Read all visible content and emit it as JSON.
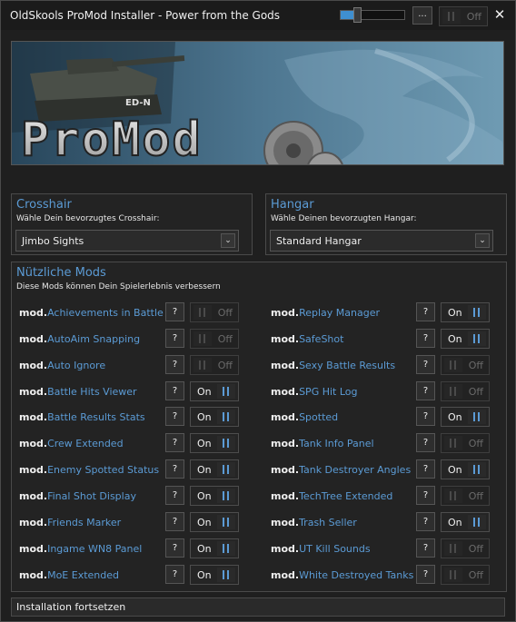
{
  "window": {
    "title": "OldSkools ProMod Installer - Power from the Gods",
    "volume_level": 0.25,
    "menu_label": "...",
    "toggle_label": "Off",
    "close_glyph": "✕"
  },
  "banner": {
    "logo_text": "ProMod",
    "tank_marking": "ED-N"
  },
  "crosshair": {
    "title": "Crosshair",
    "subtitle": "Wähle Dein bevorzugtes Crosshair:",
    "selected": "Jimbo Sights",
    "arrow": "⌄"
  },
  "hangar": {
    "title": "Hangar",
    "subtitle": "Wähle Deinen bevorzugten Hangar:",
    "selected": "Standard Hangar",
    "arrow": "⌄"
  },
  "mods": {
    "title": "Nützliche Mods",
    "subtitle": "Diese Mods können Dein Spielerlebnis verbessern",
    "prefix": "mod.",
    "help_label": "?",
    "on_label": "On",
    "off_label": "Off",
    "left": [
      {
        "name": "Achievements in Battle",
        "enabled": false
      },
      {
        "name": "AutoAim Snapping",
        "enabled": false
      },
      {
        "name": "Auto Ignore",
        "enabled": false
      },
      {
        "name": "Battle Hits Viewer",
        "enabled": true
      },
      {
        "name": "Battle Results Stats",
        "enabled": true
      },
      {
        "name": "Crew Extended",
        "enabled": true
      },
      {
        "name": "Enemy Spotted Status",
        "enabled": true
      },
      {
        "name": "Final Shot Display",
        "enabled": true
      },
      {
        "name": "Friends Marker",
        "enabled": true
      },
      {
        "name": "Ingame WN8 Panel",
        "enabled": true
      },
      {
        "name": "MoE Extended",
        "enabled": true
      }
    ],
    "right": [
      {
        "name": "Replay Manager",
        "enabled": true
      },
      {
        "name": "SafeShot",
        "enabled": true
      },
      {
        "name": "Sexy Battle Results",
        "enabled": false
      },
      {
        "name": "SPG Hit Log",
        "enabled": false
      },
      {
        "name": "Spotted",
        "enabled": true
      },
      {
        "name": "Tank Info Panel",
        "enabled": false
      },
      {
        "name": "Tank Destroyer Angles",
        "enabled": true
      },
      {
        "name": "TechTree Extended",
        "enabled": false
      },
      {
        "name": "Trash Seller",
        "enabled": true
      },
      {
        "name": "UT Kill Sounds",
        "enabled": false
      },
      {
        "name": "White Destroyed Tanks",
        "enabled": false
      }
    ]
  },
  "footer": {
    "install_label": "Installation fortsetzen"
  },
  "colors": {
    "accent": "#5b9bd5",
    "background": "#1f1f1f",
    "panel": "#232323"
  }
}
